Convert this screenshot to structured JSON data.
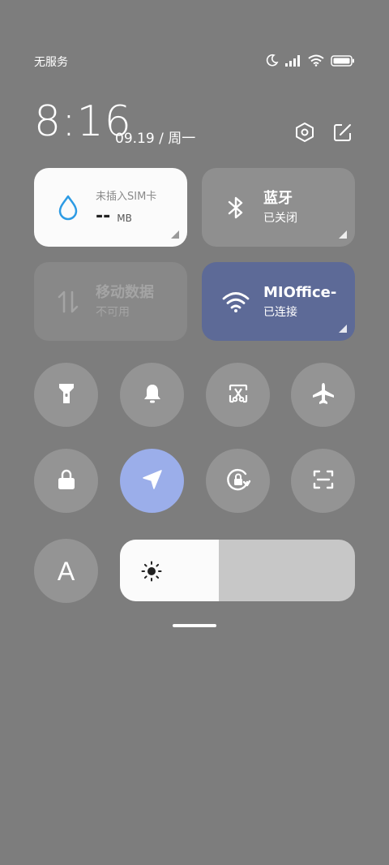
{
  "status_bar": {
    "carrier": "无服务",
    "icons": [
      "moon-icon",
      "signal-icon",
      "wifi-icon",
      "battery-icon"
    ]
  },
  "header": {
    "time": "8:16",
    "date": "09.19 / 周一",
    "icons": [
      "settings-icon",
      "edit-icon"
    ]
  },
  "tiles": {
    "data": {
      "title": "未插入SIM卡",
      "usage": "--",
      "unit": "MB",
      "icon": "water-drop-icon"
    },
    "bluetooth": {
      "title": "蓝牙",
      "status": "已关闭",
      "icon": "bluetooth-icon"
    },
    "mobile_data": {
      "title": "移动数据",
      "status": "不可用",
      "icon": "data-arrows-icon"
    },
    "wifi": {
      "title": "MIOffice-",
      "status": "已连接",
      "icon": "wifi-icon"
    }
  },
  "toggles": [
    {
      "name": "flashlight",
      "icon": "flashlight-icon",
      "active": false
    },
    {
      "name": "mute",
      "icon": "bell-icon",
      "active": false
    },
    {
      "name": "screenshot",
      "icon": "screenshot-icon",
      "active": false
    },
    {
      "name": "airplane",
      "icon": "airplane-icon",
      "active": false
    },
    {
      "name": "lock",
      "icon": "lock-icon",
      "active": false
    },
    {
      "name": "location",
      "icon": "location-icon",
      "active": true
    },
    {
      "name": "rotation-lock",
      "icon": "rotation-lock-icon",
      "active": false
    },
    {
      "name": "scanner",
      "icon": "scan-icon",
      "active": false
    }
  ],
  "bottom": {
    "font_label": "A",
    "brightness_level": 0.42
  },
  "colors": {
    "background": "#7d7d7d",
    "tile_light": "#fbfbfb",
    "tile_dark": "#8f8f8f",
    "wifi_active": "#5d6a97",
    "location_active": "#9baeea",
    "water_drop": "#2d9be4"
  }
}
